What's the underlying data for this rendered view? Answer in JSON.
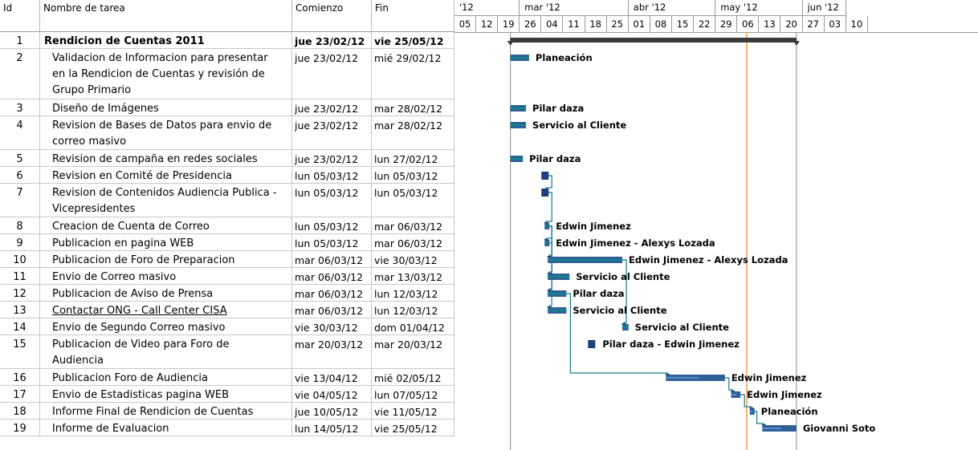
{
  "columns": {
    "id": "Id",
    "name": "Nombre de tarea",
    "start": "Comienzo",
    "end": "Fin"
  },
  "timescale": {
    "months": [
      {
        "label": "'12",
        "start": 0,
        "end": 3
      },
      {
        "label": "mar '12",
        "start": 3,
        "end": 8
      },
      {
        "label": "abr '12",
        "start": 8,
        "end": 12
      },
      {
        "label": "may '12",
        "start": 12,
        "end": 16
      },
      {
        "label": "jun '12",
        "start": 16,
        "end": 18
      }
    ],
    "weeks": [
      "05",
      "12",
      "19",
      "26",
      "04",
      "11",
      "18",
      "25",
      "01",
      "08",
      "15",
      "22",
      "29",
      "06",
      "13",
      "20",
      "27",
      "03",
      "10"
    ],
    "first_week_start": "2012-02-05",
    "week_width": 27.1
  },
  "status_line_date": "2012-05-09",
  "tasks": [
    {
      "id": "1",
      "lines": [
        "Rendicion de Cuentas 2011"
      ],
      "start": "jue 23/02/12",
      "end": "vie 25/05/12",
      "s": "2012-02-23",
      "e": "2012-05-25",
      "summary": true,
      "label": ""
    },
    {
      "id": "2",
      "lines": [
        "Validacion de Informacion para presentar",
        "en la Rendicion de Cuentas y revisión de",
        "Grupo Primario"
      ],
      "start": "jue 23/02/12",
      "end": "mié 29/02/12",
      "s": "2012-02-23",
      "e": "2012-02-29",
      "label": "Planeación"
    },
    {
      "id": "3",
      "lines": [
        "Diseño de Imágenes"
      ],
      "start": "jue 23/02/12",
      "end": "mar 28/02/12",
      "s": "2012-02-23",
      "e": "2012-02-28",
      "label": "Pilar daza"
    },
    {
      "id": "4",
      "lines": [
        "Revision de Bases de Datos para envio de",
        "correo masivo"
      ],
      "start": "jue 23/02/12",
      "end": "mar 28/02/12",
      "s": "2012-02-23",
      "e": "2012-02-28",
      "label": "Servicio al Cliente"
    },
    {
      "id": "5",
      "lines": [
        "Revision de campaña en redes sociales"
      ],
      "start": "jue 23/02/12",
      "end": "lun 27/02/12",
      "s": "2012-02-23",
      "e": "2012-02-27",
      "label": "Pilar daza"
    },
    {
      "id": "6",
      "lines": [
        "Revision en Comité de Presidencia"
      ],
      "start": "lun 05/03/12",
      "end": "lun 05/03/12",
      "s": "2012-03-05",
      "e": "2012-03-05",
      "label": ""
    },
    {
      "id": "7",
      "lines": [
        "Revision de Contenidos Audiencia Publica -",
        "Vicepresidentes"
      ],
      "start": "lun 05/03/12",
      "end": "lun 05/03/12",
      "s": "2012-03-05",
      "e": "2012-03-05",
      "label": ""
    },
    {
      "id": "8",
      "lines": [
        "Creacion de Cuenta de Correo"
      ],
      "start": "lun 05/03/12",
      "end": "mar 06/03/12",
      "s": "2012-03-05",
      "e": "2012-03-06",
      "label": "Edwin Jimenez"
    },
    {
      "id": "9",
      "lines": [
        "Publicacion en pagina WEB"
      ],
      "start": "lun 05/03/12",
      "end": "mar 06/03/12",
      "s": "2012-03-05",
      "e": "2012-03-06",
      "label": "Edwin Jimenez - Alexys Lozada"
    },
    {
      "id": "10",
      "lines": [
        "Publicacion de Foro de Preparacion"
      ],
      "start": "mar 06/03/12",
      "end": "vie 30/03/12",
      "s": "2012-03-06",
      "e": "2012-03-30",
      "label": "Edwin Jimenez - Alexys Lozada"
    },
    {
      "id": "11",
      "lines": [
        "Envio de Correo masivo"
      ],
      "start": "mar 06/03/12",
      "end": "mar 13/03/12",
      "s": "2012-03-06",
      "e": "2012-03-13",
      "label": "Servicio al Cliente"
    },
    {
      "id": "12",
      "lines": [
        "Publicacion de Aviso de Prensa"
      ],
      "start": "mar 06/03/12",
      "end": "lun 12/03/12",
      "s": "2012-03-06",
      "e": "2012-03-12",
      "label": "Pilar daza"
    },
    {
      "id": "13",
      "lines": [
        "Contactar ONG - Call Center CISA"
      ],
      "start": "mar 06/03/12",
      "end": "lun 12/03/12",
      "s": "2012-03-06",
      "e": "2012-03-12",
      "label": "Servicio al Cliente",
      "link": true
    },
    {
      "id": "14",
      "lines": [
        "Envio de  Segundo Correo masivo"
      ],
      "start": "vie 30/03/12",
      "end": "dom 01/04/12",
      "s": "2012-03-30",
      "e": "2012-04-01",
      "label": "Servicio al Cliente"
    },
    {
      "id": "15",
      "lines": [
        "Publicacion de Video para Foro de",
        "Audiencia"
      ],
      "start": "mar 20/03/12",
      "end": "mar 20/03/12",
      "s": "2012-03-20",
      "e": "2012-03-20",
      "label": "Pilar daza - Edwin Jimenez"
    },
    {
      "id": "16",
      "lines": [
        "Publicacion Foro de Audiencia"
      ],
      "start": "vie 13/04/12",
      "end": "mié 02/05/12",
      "s": "2012-04-13",
      "e": "2012-05-02",
      "label": "Edwin Jimenez"
    },
    {
      "id": "17",
      "lines": [
        "Envio de Estadisticas pagina WEB"
      ],
      "start": "vie 04/05/12",
      "end": "lun 07/05/12",
      "s": "2012-05-04",
      "e": "2012-05-07",
      "label": "Edwin Jimenez"
    },
    {
      "id": "18",
      "lines": [
        "Informe Final de Rendicion de Cuentas"
      ],
      "start": "jue 10/05/12",
      "end": "vie 11/05/12",
      "s": "2012-05-10",
      "e": "2012-05-11",
      "label": "Planeación"
    },
    {
      "id": "19",
      "lines": [
        "Informe de Evaluacion"
      ],
      "start": "lun 14/05/12",
      "end": "vie 25/05/12",
      "s": "2012-05-14",
      "e": "2012-05-25",
      "label": "Giovanni Soto"
    }
  ],
  "dependencies": [
    [
      "6",
      "7"
    ],
    [
      "7",
      "8"
    ],
    [
      "8",
      "9"
    ],
    [
      "9",
      "10"
    ],
    [
      "8",
      "11"
    ],
    [
      "8",
      "12"
    ],
    [
      "8",
      "13"
    ],
    [
      "10",
      "14"
    ],
    [
      "12",
      "16"
    ],
    [
      "16",
      "17"
    ],
    [
      "17",
      "18"
    ],
    [
      "18",
      "19"
    ]
  ],
  "colors": {
    "task_bar": "#2f6196",
    "done_bar": "#0c8a8a",
    "summary_bar": "#3a3a3a",
    "status_line": "#f0a050",
    "grid": "#c8c8c8",
    "arrow": "#1a7a8a"
  }
}
